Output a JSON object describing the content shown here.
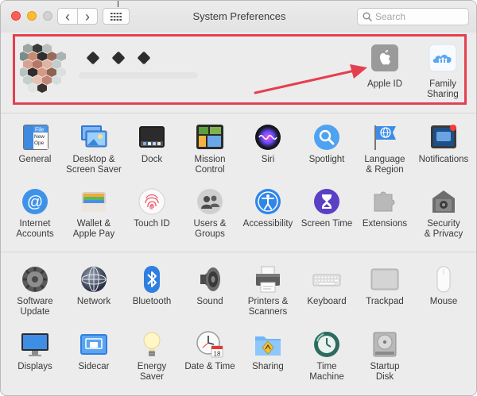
{
  "window": {
    "title": "System Preferences",
    "search_placeholder": "Search",
    "nav_back": "‹",
    "nav_forward": "›"
  },
  "account": {
    "items": [
      {
        "label": "Apple ID",
        "icon": "apple-id-icon"
      },
      {
        "label": "Family\nSharing",
        "icon": "family-sharing-icon"
      }
    ]
  },
  "row1": [
    {
      "label": "General",
      "icon": "general-icon"
    },
    {
      "label": "Desktop &\nScreen Saver",
      "icon": "desktop-screensaver-icon"
    },
    {
      "label": "Dock",
      "icon": "dock-icon"
    },
    {
      "label": "Mission\nControl",
      "icon": "mission-control-icon"
    },
    {
      "label": "Siri",
      "icon": "siri-icon"
    },
    {
      "label": "Spotlight",
      "icon": "spotlight-icon"
    },
    {
      "label": "Language\n& Region",
      "icon": "language-region-icon"
    },
    {
      "label": "Notifications",
      "icon": "notifications-icon"
    }
  ],
  "row2": [
    {
      "label": "Internet\nAccounts",
      "icon": "internet-accounts-icon"
    },
    {
      "label": "Wallet &\nApple Pay",
      "icon": "wallet-icon"
    },
    {
      "label": "Touch ID",
      "icon": "touch-id-icon"
    },
    {
      "label": "Users &\nGroups",
      "icon": "users-groups-icon"
    },
    {
      "label": "Accessibility",
      "icon": "accessibility-icon"
    },
    {
      "label": "Screen Time",
      "icon": "screen-time-icon"
    },
    {
      "label": "Extensions",
      "icon": "extensions-icon"
    },
    {
      "label": "Security\n& Privacy",
      "icon": "security-icon"
    }
  ],
  "row3": [
    {
      "label": "Software\nUpdate",
      "icon": "software-update-icon"
    },
    {
      "label": "Network",
      "icon": "network-icon"
    },
    {
      "label": "Bluetooth",
      "icon": "bluetooth-icon"
    },
    {
      "label": "Sound",
      "icon": "sound-icon"
    },
    {
      "label": "Printers &\nScanners",
      "icon": "printer-icon"
    },
    {
      "label": "Keyboard",
      "icon": "keyboard-icon"
    },
    {
      "label": "Trackpad",
      "icon": "trackpad-icon"
    },
    {
      "label": "Mouse",
      "icon": "mouse-icon"
    }
  ],
  "row4": [
    {
      "label": "Displays",
      "icon": "displays-icon"
    },
    {
      "label": "Sidecar",
      "icon": "sidecar-icon"
    },
    {
      "label": "Energy\nSaver",
      "icon": "energy-saver-icon"
    },
    {
      "label": "Date & Time",
      "icon": "date-time-icon"
    },
    {
      "label": "Sharing",
      "icon": "sharing-icon"
    },
    {
      "label": "Time\nMachine",
      "icon": "time-machine-icon"
    },
    {
      "label": "Startup\nDisk",
      "icon": "startup-disk-icon"
    }
  ],
  "colors": {
    "highlight": "#e53f4f",
    "window_bg": "#ececec"
  }
}
